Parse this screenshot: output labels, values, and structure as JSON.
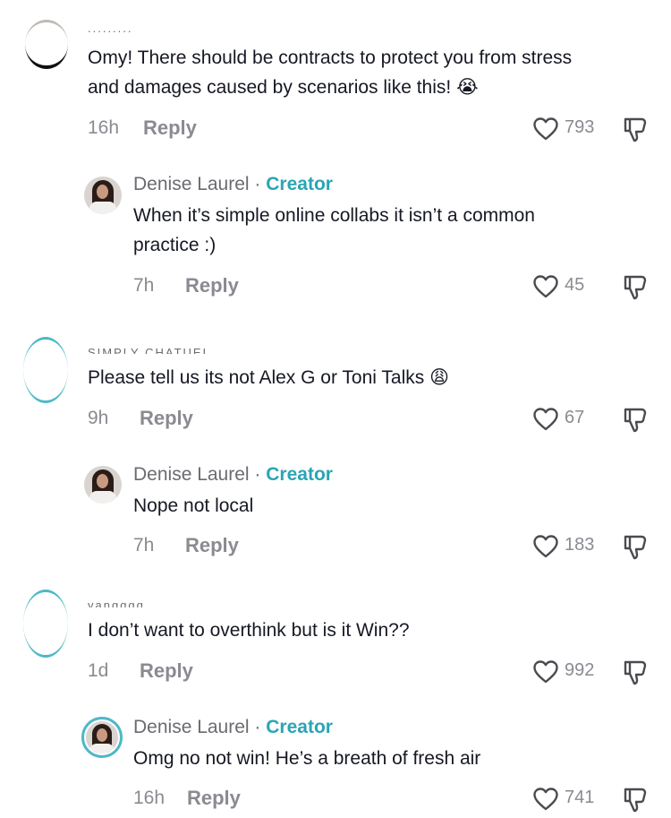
{
  "comments": [
    {
      "username_cut": ".........",
      "text_line1": "Omy! There should be contracts to protect you from stress",
      "text_line2": "and damages caused by scenarios like this!",
      "emoji": "😭",
      "time": "16h",
      "reply_label": "Reply",
      "likes": "793",
      "reply": {
        "author": "Denise Laurel",
        "dot": " · ",
        "badge": "Creator",
        "text_line1": "When it’s simple online collabs it isn’t a common",
        "text_line2": "practice :)",
        "time": "7h",
        "reply_label": "Reply",
        "likes": "45"
      }
    },
    {
      "username_cut": "SIMPLY CHATUEL",
      "text": "Please tell us its not Alex G or Toni Talks",
      "emoji": "😩",
      "time": "9h",
      "reply_label": "Reply",
      "likes": "67",
      "reply": {
        "author": "Denise Laurel",
        "dot": " · ",
        "badge": "Creator",
        "text": "Nope not local",
        "time": "7h",
        "reply_label": "Reply",
        "likes": "183"
      }
    },
    {
      "username_cut": "yangggg..",
      "text": "I don’t want to overthink but is it Win??",
      "time": "1d",
      "reply_label": "Reply",
      "likes": "992",
      "reply": {
        "author": "Denise Laurel",
        "dot": " · ",
        "badge": "Creator",
        "text": "Omg no not win! He’s a breath of fresh air",
        "time": "16h",
        "reply_label": "Reply",
        "likes": "741"
      }
    }
  ],
  "colors": {
    "creator": "#2ba4b5",
    "muted": "#8a8b91",
    "text": "#161823"
  },
  "icons": [
    "heart-icon",
    "dislike-icon"
  ]
}
